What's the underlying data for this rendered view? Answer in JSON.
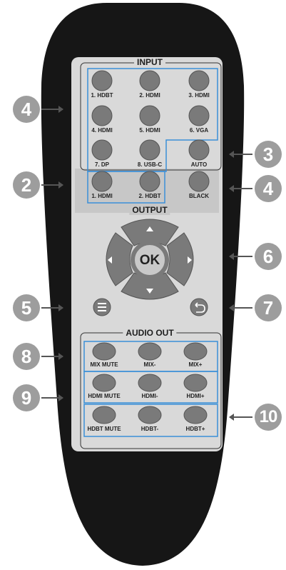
{
  "remote": {
    "input_title": "INPUT",
    "output_title": "OUTPUT",
    "audio_title": "AUDIO OUT",
    "ok_label": "OK",
    "input_buttons": [
      {
        "label": "1. HDBT"
      },
      {
        "label": "2. HDMI"
      },
      {
        "label": "3. HDMI"
      },
      {
        "label": "4. HDMI"
      },
      {
        "label": "5. HDMI"
      },
      {
        "label": "6. VGA"
      },
      {
        "label": "7. DP"
      },
      {
        "label": "8. USB-C"
      },
      {
        "label": "AUTO"
      }
    ],
    "output_buttons": [
      {
        "label": "1. HDMI"
      },
      {
        "label": "2. HDBT"
      },
      {
        "label": "BLACK"
      }
    ],
    "audio_buttons": [
      {
        "label": "MIX MUTE"
      },
      {
        "label": "MIX-"
      },
      {
        "label": "MIX+"
      },
      {
        "label": "HDMI MUTE"
      },
      {
        "label": "HDMI-"
      },
      {
        "label": "HDMI+"
      },
      {
        "label": "HDBT MUTE"
      },
      {
        "label": "HDBT-"
      },
      {
        "label": "HDBT+"
      }
    ]
  },
  "callouts": {
    "c4_left": "4",
    "c2": "2",
    "c5": "5",
    "c8": "8",
    "c9": "9",
    "c3": "3",
    "c4_right": "4",
    "c6": "6",
    "c7": "7",
    "c10": "10"
  },
  "colors": {
    "body": "#161616",
    "panel": "#d9d9d9",
    "output_band": "#c7c7c7",
    "button": "#7a7a7a",
    "highlight_box": "#3a8fd8",
    "callout": "#9d9d9d"
  }
}
